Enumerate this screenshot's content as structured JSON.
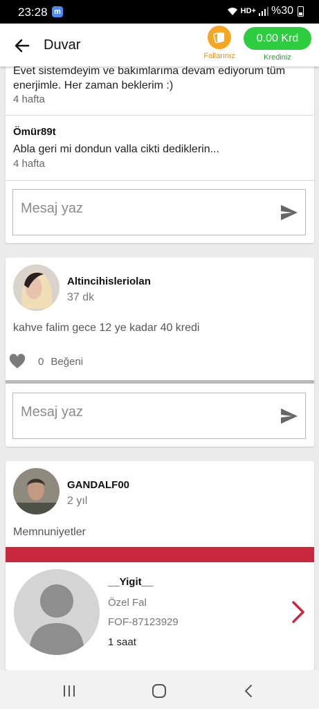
{
  "status_bar": {
    "time": "23:28",
    "app_badge": "m",
    "network": "HD+",
    "battery": "%30"
  },
  "app_bar": {
    "title": "Duvar",
    "fallar_label": "Fallarınız",
    "credit_value": "0.00 Krd",
    "credit_label": "Krediniz"
  },
  "card1": {
    "comments": [
      {
        "text": "Evet sistemdeyim ve bakımlarıma devam ediyorum tüm enerjimle. Her zaman beklerim :)",
        "time": "4 hafta"
      },
      {
        "author": "Ömür89t",
        "text": "Abla geri mi dondun valla cikti dediklerin...",
        "time": "4 hafta"
      }
    ],
    "message_placeholder": "Mesaj yaz"
  },
  "card2": {
    "username": "Altincihisleriolan",
    "time": "37 dk",
    "text": "kahve falim gece 12 ye kadar 40 kredi",
    "like_count": "0",
    "like_label": "Beğeni",
    "message_placeholder": "Mesaj yaz"
  },
  "card3": {
    "username": "GANDALF00",
    "time": "2 yıl",
    "section_label": "Memnuniyetler",
    "inner": {
      "name": "__Yigit__",
      "type": "Özel Fal",
      "code": "FOF-87123929",
      "time": "1 saat"
    }
  },
  "colors": {
    "accent_red": "#c8283e",
    "credit_green": "#2ecc3f",
    "fallar_orange": "#f5a623"
  }
}
